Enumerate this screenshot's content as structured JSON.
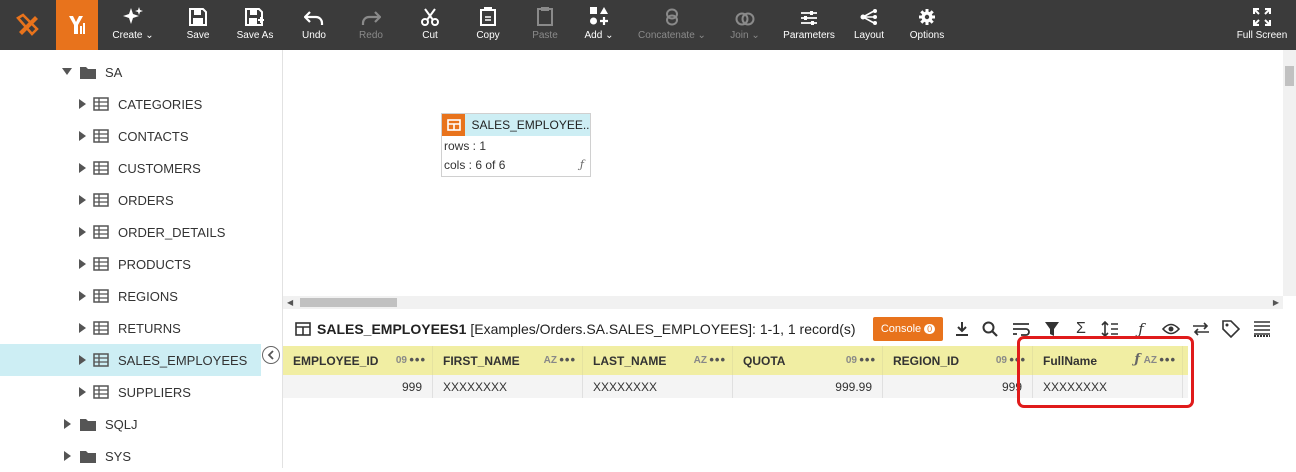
{
  "toolbar": {
    "buttons": [
      {
        "label": "Create",
        "icon": "sparkle-icon",
        "dropdown": true,
        "enabled": true
      },
      {
        "label": "Save",
        "icon": "save-icon",
        "enabled": true
      },
      {
        "label": "Save As",
        "icon": "save-as-icon",
        "enabled": true
      },
      {
        "label": "Undo",
        "icon": "undo-icon",
        "enabled": true
      },
      {
        "label": "Redo",
        "icon": "redo-icon",
        "enabled": false
      },
      {
        "label": "Cut",
        "icon": "cut-icon",
        "enabled": true
      },
      {
        "label": "Copy",
        "icon": "copy-icon",
        "enabled": true
      },
      {
        "label": "Paste",
        "icon": "paste-icon",
        "enabled": false
      },
      {
        "label": "Add",
        "icon": "add-shapes-icon",
        "dropdown": true,
        "enabled": true
      },
      {
        "label": "Concatenate",
        "icon": "concatenate-icon",
        "dropdown": true,
        "enabled": false
      },
      {
        "label": "Join",
        "icon": "join-icon",
        "dropdown": true,
        "enabled": false
      },
      {
        "label": "Parameters",
        "icon": "sliders-icon",
        "enabled": true
      },
      {
        "label": "Layout",
        "icon": "layout-icon",
        "enabled": true
      },
      {
        "label": "Options",
        "icon": "gear-icon",
        "enabled": true
      }
    ],
    "fullscreen_label": "Full Screen"
  },
  "sidebar": {
    "schema": "SA",
    "tables": [
      "CATEGORIES",
      "CONTACTS",
      "CUSTOMERS",
      "ORDERS",
      "ORDER_DETAILS",
      "PRODUCTS",
      "REGIONS",
      "RETURNS",
      "SALES_EMPLOYEES",
      "SUPPLIERS"
    ],
    "selected": "SALES_EMPLOYEES",
    "other_schemas": [
      "SQLJ",
      "SYS"
    ]
  },
  "canvas": {
    "node": {
      "title": "SALES_EMPLOYEE...",
      "rows": "rows : 1",
      "cols": "cols : 6 of 6"
    }
  },
  "results": {
    "name": "SALES_EMPLOYEES1",
    "description": "[Examples/Orders.SA.SALES_EMPLOYEES]: 1-1, 1 record(s)",
    "console_label": "Console",
    "console_count": "0",
    "columns": [
      {
        "name": "EMPLOYEE_ID",
        "type": "09"
      },
      {
        "name": "FIRST_NAME",
        "type": "AZ"
      },
      {
        "name": "LAST_NAME",
        "type": "AZ"
      },
      {
        "name": "QUOTA",
        "type": "09"
      },
      {
        "name": "REGION_ID",
        "type": "09"
      },
      {
        "name": "FullName",
        "type": "AZ",
        "formula": true
      }
    ],
    "rows": [
      [
        "999",
        "XXXXXXXX",
        "XXXXXXXX",
        "999.99",
        "999",
        "XXXXXXXX"
      ]
    ]
  },
  "colors": {
    "accent": "#e8731c",
    "toolbar_bg": "#3b3b3b",
    "selection": "#cdeef4",
    "grid_header": "#f1eea3",
    "highlight": "#e01b1b"
  }
}
